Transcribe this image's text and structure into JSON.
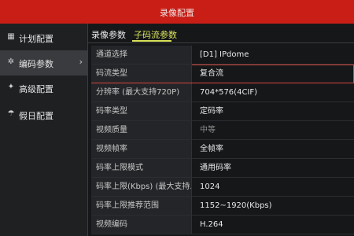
{
  "window": {
    "title": "录像配置"
  },
  "sidebar": {
    "items": [
      {
        "icon": "calendar-icon",
        "label": "计划配置",
        "active": false
      },
      {
        "icon": "gear-icon",
        "label": "编码参数",
        "active": true,
        "chevron": "›"
      },
      {
        "icon": "sliders-icon",
        "label": "高级配置",
        "active": false
      },
      {
        "icon": "umbrella-icon",
        "label": "假日配置",
        "active": false
      }
    ]
  },
  "tabs": [
    {
      "label": "录像参数",
      "active": false
    },
    {
      "label": "子码流参数",
      "active": true
    }
  ],
  "params": [
    {
      "label": "通道选择",
      "value": "[D1] IPdome"
    },
    {
      "label": "码流类型",
      "value": "复合流"
    },
    {
      "label": "分辨率 (最大支持720P)",
      "value": "704*576(4CIF)"
    },
    {
      "label": "码率类型",
      "value": "定码率"
    },
    {
      "label": "视频质量",
      "value": "中等"
    },
    {
      "label": "视频帧率",
      "value": "全帧率"
    },
    {
      "label": "码率上限模式",
      "value": "通用码率"
    },
    {
      "label": "码率上限(Kbps) (最大支持...",
      "value": "1024"
    },
    {
      "label": "码率上限推荐范围",
      "value": "1152~1920(Kbps)"
    },
    {
      "label": "视频编码",
      "value": "H.264"
    }
  ],
  "colors": {
    "titlebar": "#c81e16",
    "active_tab": "#d9e45a",
    "highlight_border": "#d4473f"
  }
}
